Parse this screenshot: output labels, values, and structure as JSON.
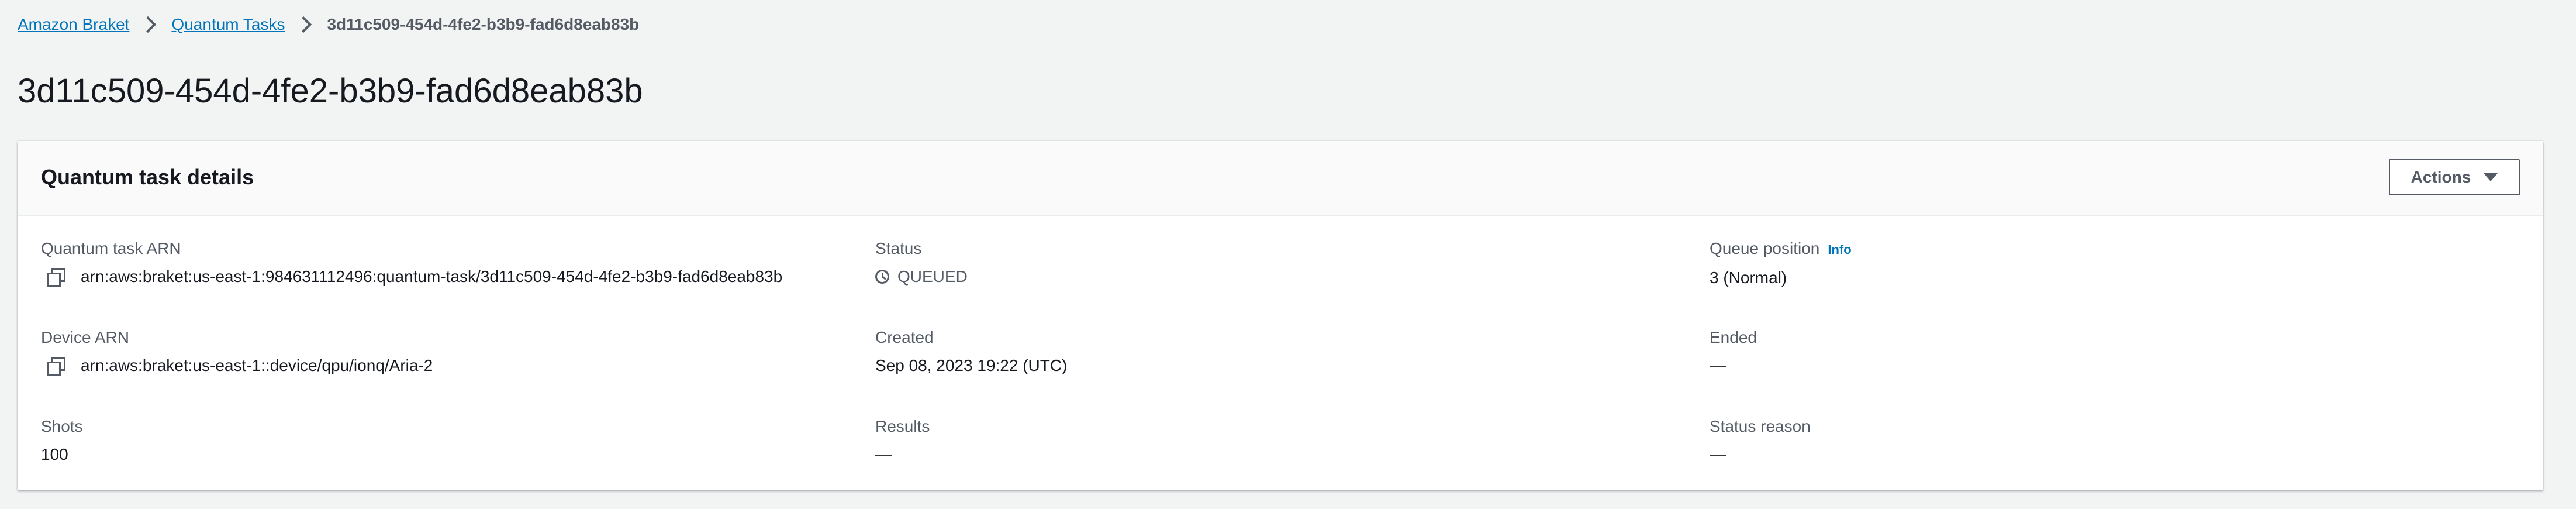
{
  "breadcrumb": {
    "items": [
      {
        "label": "Amazon Braket"
      },
      {
        "label": "Quantum Tasks"
      }
    ],
    "current": "3d11c509-454d-4fe2-b3b9-fad6d8eab83b"
  },
  "page": {
    "title": "3d11c509-454d-4fe2-b3b9-fad6d8eab83b"
  },
  "panel": {
    "title": "Quantum task details",
    "actions_label": "Actions"
  },
  "fields": {
    "task_arn": {
      "label": "Quantum task ARN",
      "value": "arn:aws:braket:us-east-1:984631112496:quantum-task/3d11c509-454d-4fe2-b3b9-fad6d8eab83b"
    },
    "status": {
      "label": "Status",
      "value": "QUEUED"
    },
    "queue_position": {
      "label": "Queue position",
      "info": "Info",
      "value": "3 (Normal)"
    },
    "device_arn": {
      "label": "Device ARN",
      "value": "arn:aws:braket:us-east-1::device/qpu/ionq/Aria-2"
    },
    "created": {
      "label": "Created",
      "value": "Sep 08, 2023 19:22 (UTC)"
    },
    "ended": {
      "label": "Ended",
      "value": "—"
    },
    "shots": {
      "label": "Shots",
      "value": "100"
    },
    "results": {
      "label": "Results",
      "value": "—"
    },
    "status_reason": {
      "label": "Status reason",
      "value": "—"
    }
  },
  "icons": {
    "copy": "copy-icon",
    "status": "clock-icon",
    "caret": "caret-down-icon",
    "breadcrumb_separator": "chevron-right-icon"
  },
  "colors": {
    "link": "#0073bb",
    "text": "#16191f",
    "muted": "#545b64",
    "background": "#f2f3f3"
  }
}
